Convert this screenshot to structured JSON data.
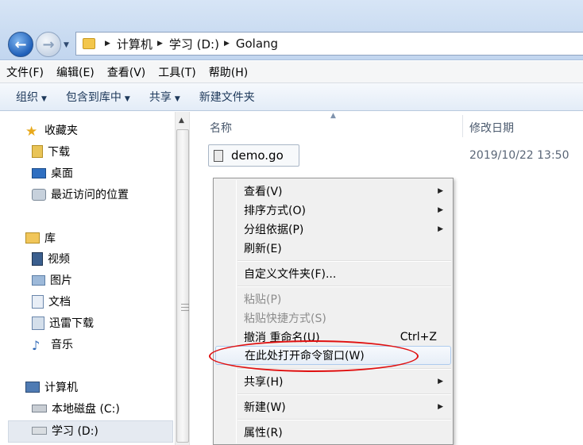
{
  "address": {
    "crumbs": [
      "计算机",
      "学习 (D:)",
      "Golang"
    ]
  },
  "menubar": [
    "文件(F)",
    "编辑(E)",
    "查看(V)",
    "工具(T)",
    "帮助(H)"
  ],
  "toolbar": {
    "organize": "组织",
    "include": "包含到库中",
    "share": "共享",
    "new_folder": "新建文件夹"
  },
  "nav": {
    "favorites": "收藏夹",
    "downloads": "下载",
    "desktop": "桌面",
    "recent": "最近访问的位置",
    "libraries": "库",
    "videos": "视频",
    "pictures": "图片",
    "documents": "文档",
    "xunlei": "迅雷下载",
    "music": "音乐",
    "computer": "计算机",
    "local_disk": "本地磁盘 (C:)",
    "study_disk": "学习 (D:)"
  },
  "content": {
    "col_name": "名称",
    "col_date": "修改日期",
    "files": [
      {
        "name": "demo.go",
        "date": "2019/10/22 13:50"
      }
    ]
  },
  "context_menu": {
    "view": "查看(V)",
    "sort": "排序方式(O)",
    "group": "分组依据(P)",
    "refresh": "刷新(E)",
    "customize": "自定义文件夹(F)...",
    "paste": "粘贴(P)",
    "paste_shortcut": "粘贴快捷方式(S)",
    "undo": "撤消 重命名(U)",
    "undo_shortcut": "Ctrl+Z",
    "open_cmd": "在此处打开命令窗口(W)",
    "share": "共享(H)",
    "new": "新建(W)",
    "properties": "属性(R)"
  },
  "colors": {
    "highlight_oval": "#e01010",
    "hover_border": "#aecbee"
  }
}
